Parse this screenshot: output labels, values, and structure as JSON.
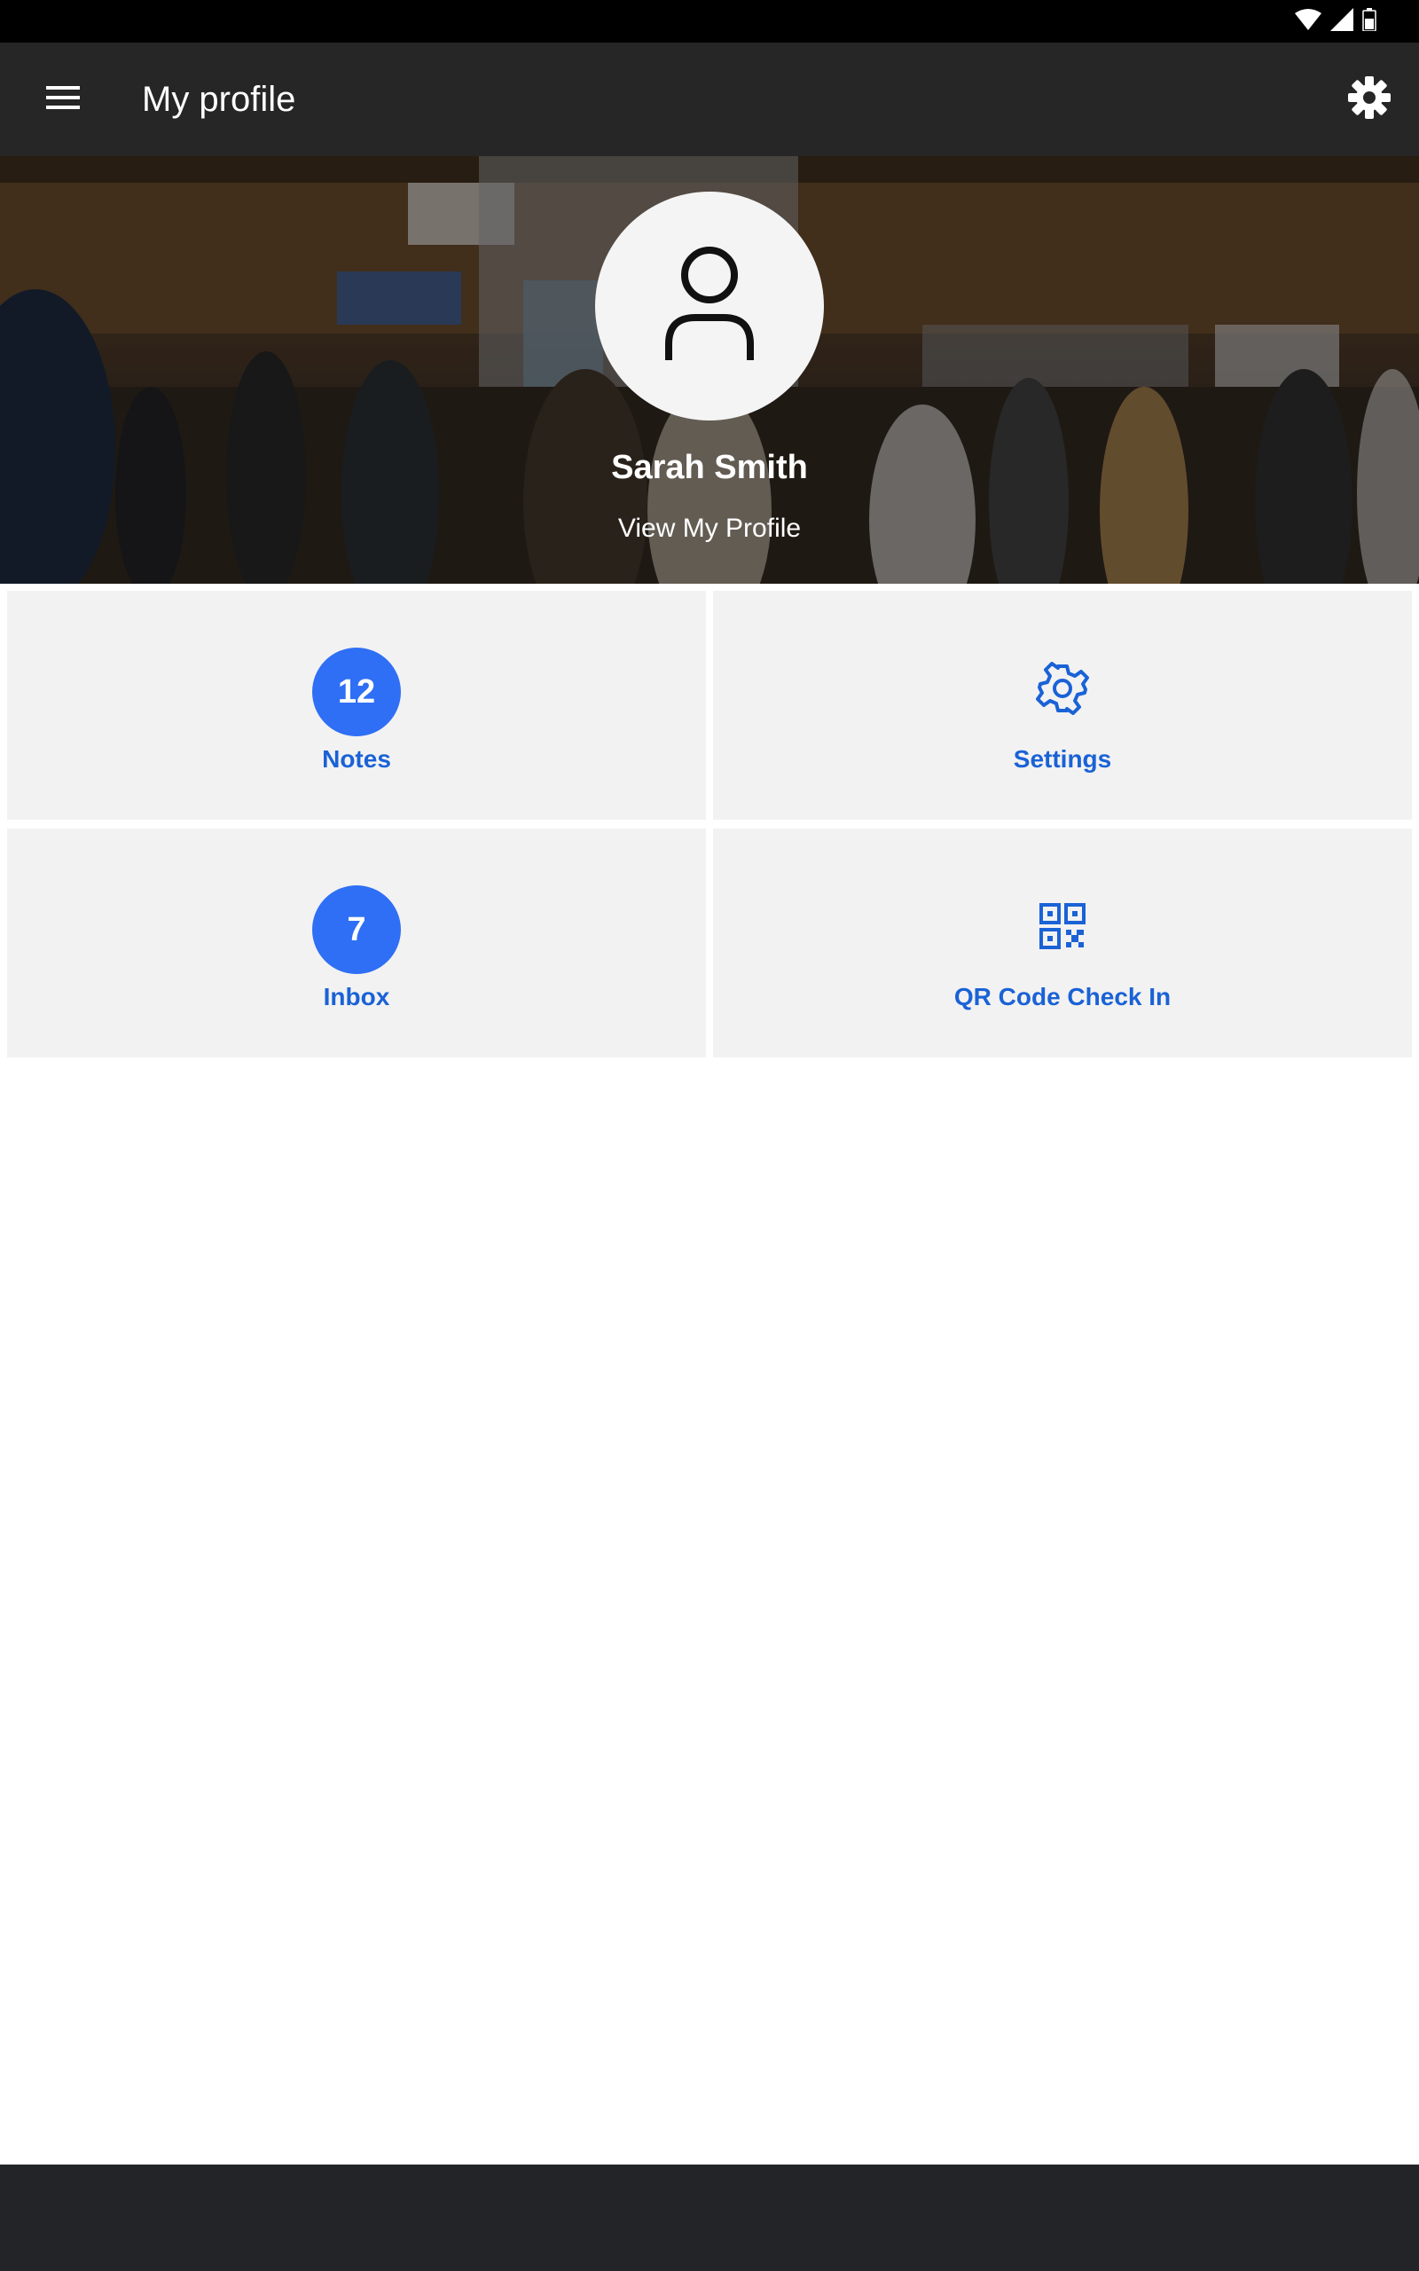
{
  "app_bar": {
    "title": "My profile",
    "menu_icon": "hamburger-menu-icon",
    "settings_icon": "gear-icon"
  },
  "status_bar": {
    "icons": [
      "wifi-icon",
      "cellular-signal-icon",
      "battery-icon"
    ]
  },
  "profile": {
    "name": "Sarah Smith",
    "view_profile_label": "View My Profile",
    "avatar_icon": "user-icon"
  },
  "tiles": {
    "notes": {
      "count": "12",
      "label": "Notes"
    },
    "settings": {
      "label": "Settings",
      "icon": "gear-outline-icon"
    },
    "inbox": {
      "count": "7",
      "label": "Inbox"
    },
    "qr_check_in": {
      "label": "QR Code Check In",
      "icon": "qr-code-icon"
    }
  },
  "colors": {
    "accent": "#2f6ff5",
    "tile_label": "#1a62d6",
    "app_bar": "#262626",
    "tile_background": "#f2f2f2",
    "bottom_bar": "#232427"
  }
}
